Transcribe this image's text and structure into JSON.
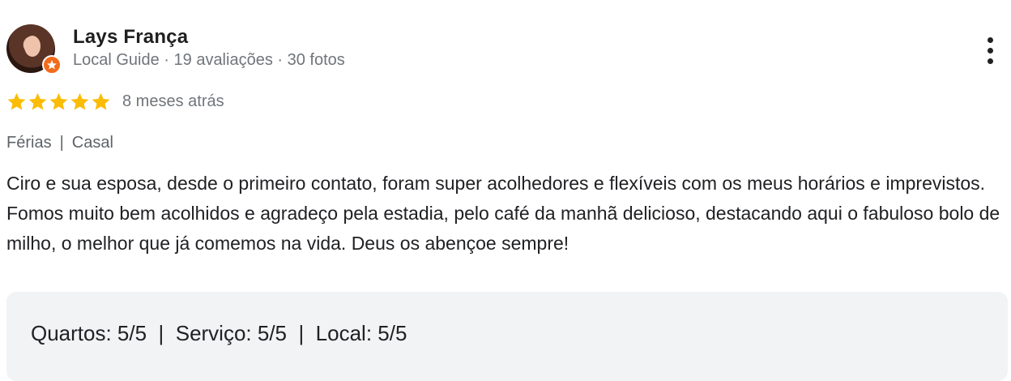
{
  "reviewer": {
    "name": "Lays França",
    "meta": "Local Guide · 19 avaliações · 30 fotos",
    "badge_icon": "local-guide-star-icon",
    "badge_color": "#f26b1d"
  },
  "review": {
    "stars": 5,
    "star_color": "#fbbc04",
    "date": "8 meses atrás",
    "tags": [
      "Férias",
      "Casal"
    ],
    "paragraphs": [
      "Ciro e sua esposa, desde o primeiro contato, foram super acolhedores e flexíveis com os meus horários e imprevistos.",
      "Fomos muito bem acolhidos e agradeço pela estadia, pelo café da manhã delicioso, destacando aqui o fabuloso bolo de milho, o melhor que já comemos na vida. Deus os abençoe sempre!"
    ],
    "sub_ratings": "Quartos: 5/5  |  Serviço: 5/5  |  Local: 5/5"
  },
  "menu_icon": "more-vertical-icon"
}
